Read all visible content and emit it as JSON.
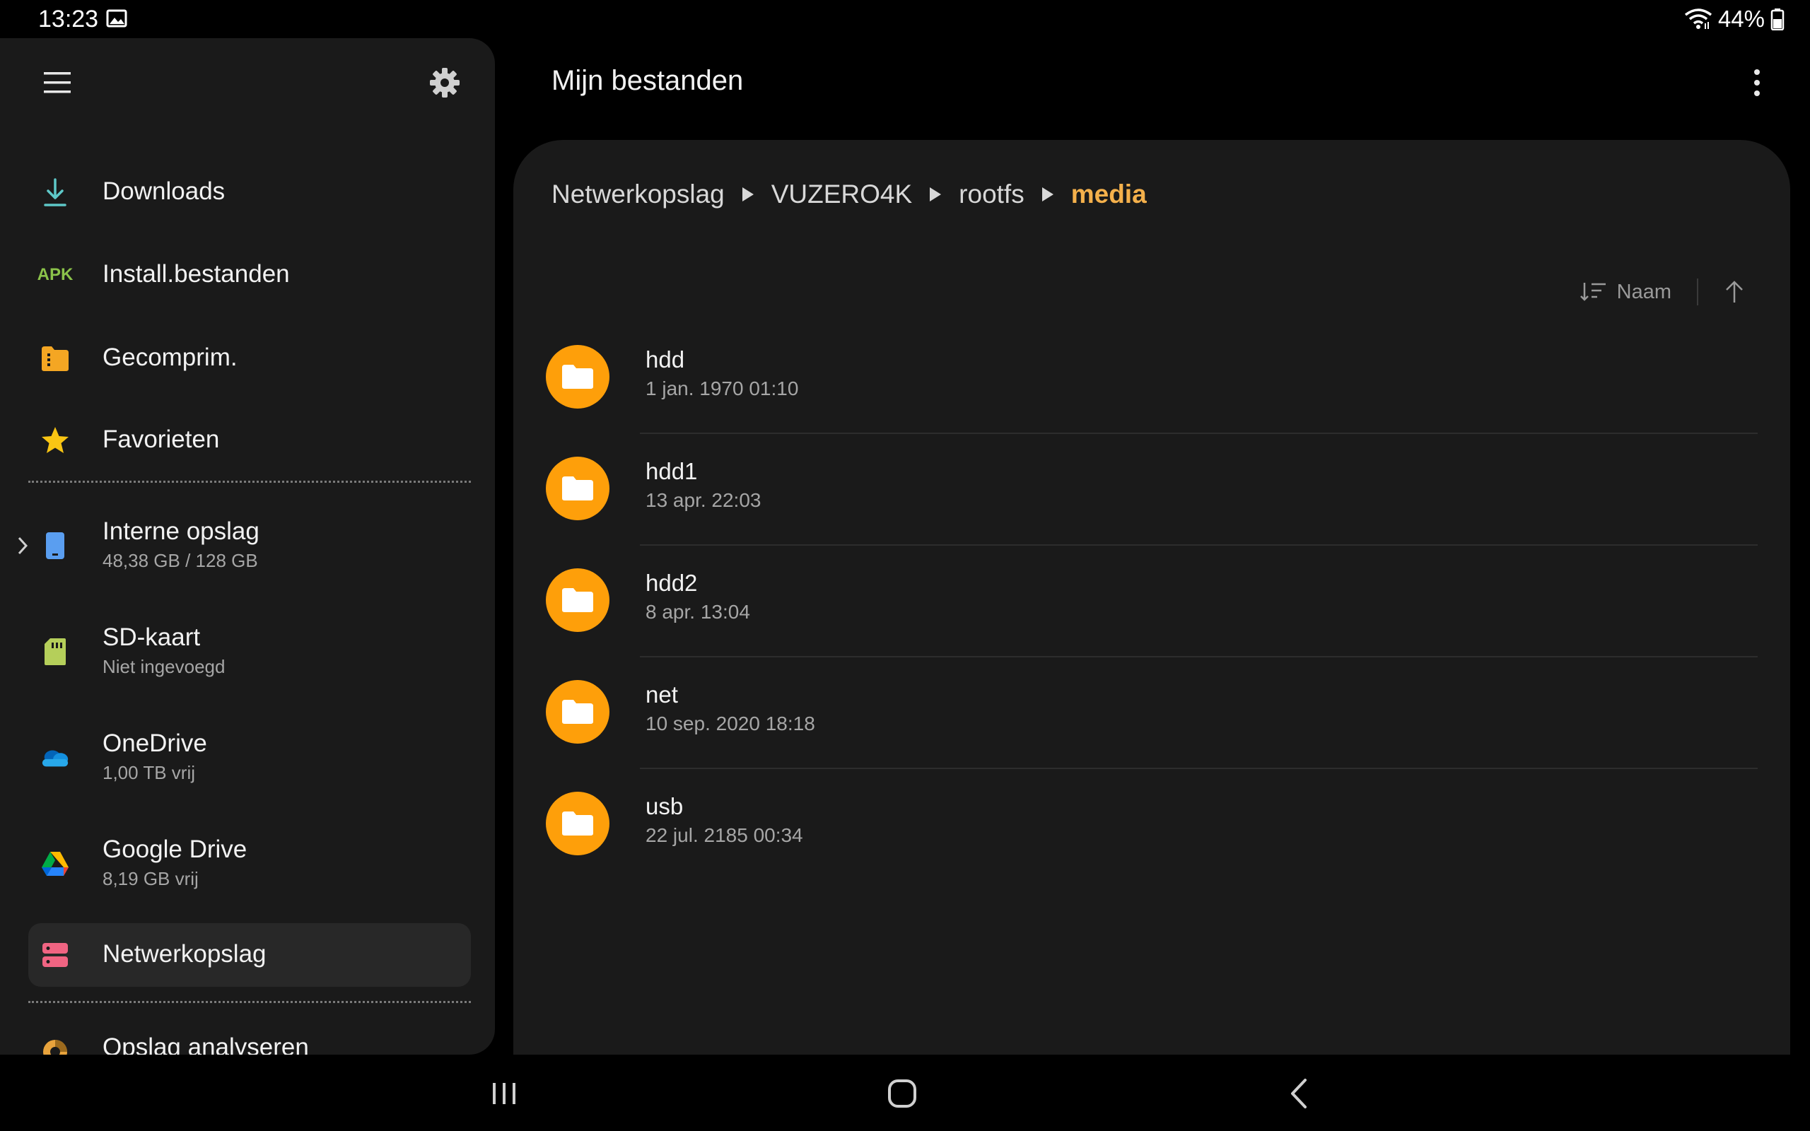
{
  "status_bar": {
    "time": "13:23",
    "battery_text": "44%",
    "icons": [
      "image-icon",
      "wifi-icon",
      "battery-icon"
    ]
  },
  "drawer": {
    "menu_icon": "hamburger-menu-icon",
    "settings_icon": "gear-icon",
    "items": [
      {
        "id": "downloads",
        "label": "Downloads",
        "icon": "download-icon"
      },
      {
        "id": "apk",
        "label": "Install.bestanden",
        "icon_text": "APK"
      },
      {
        "id": "compressed",
        "label": "Gecomprim.",
        "icon": "archive-icon"
      },
      {
        "id": "favorites",
        "label": "Favorieten",
        "icon": "star-icon"
      }
    ],
    "storage": [
      {
        "id": "internal",
        "label": "Interne opslag",
        "sub": "48,38 GB / 128 GB",
        "icon": "phone-icon"
      },
      {
        "id": "sd",
        "label": "SD-kaart",
        "sub": "Niet ingevoegd",
        "icon": "sd-card-icon"
      },
      {
        "id": "onedrive",
        "label": "OneDrive",
        "sub": "1,00 TB vrij",
        "icon": "onedrive-icon"
      },
      {
        "id": "gdrive",
        "label": "Google Drive",
        "sub": "8,19 GB vrij",
        "icon": "google-drive-icon"
      },
      {
        "id": "network",
        "label": "Netwerkopslag",
        "icon": "network-storage-icon",
        "active": true
      }
    ],
    "analyze": {
      "label": "Opslag analyseren",
      "icon": "storage-analysis-icon"
    }
  },
  "main": {
    "title": "Mijn bestanden",
    "breadcrumb": [
      "Netwerkopslag",
      "VUZERO4K",
      "rootfs",
      "media"
    ],
    "sort_label": "Naam",
    "files": [
      {
        "name": "hdd",
        "date": "1 jan. 1970 01:10"
      },
      {
        "name": "hdd1",
        "date": "13 apr. 22:03"
      },
      {
        "name": "hdd2",
        "date": "8 apr. 13:04"
      },
      {
        "name": "net",
        "date": "10 sep. 2020 18:18"
      },
      {
        "name": "usb",
        "date": "22 jul. 2185 00:34"
      }
    ]
  },
  "colors": {
    "accent": "#f4b04b",
    "folder": "#fe9f0a",
    "panel": "#1a1a1a"
  }
}
